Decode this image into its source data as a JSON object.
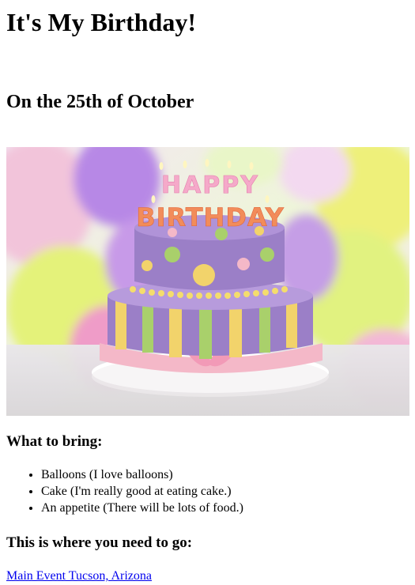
{
  "header": {
    "title": "It's My Birthday!",
    "subtitle": "On the 25th of October"
  },
  "hero": {
    "cake_text_top": "HAPPY",
    "cake_text_bottom": "BIRTHDAY",
    "colors": {
      "cake_purple": "#9b7fc7",
      "stripe_yellow": "#f2d36b",
      "stripe_green": "#a9d06b",
      "ribbon_pink": "#f4b8c8",
      "balloon_yellow": "#e8f06a",
      "balloon_purple": "#c6a2e8"
    }
  },
  "bring": {
    "heading": "What to bring:",
    "items": [
      "Balloons (I love balloons)",
      "Cake (I'm really good at eating cake.)",
      "An appetite (There will be lots of food.)"
    ]
  },
  "location": {
    "heading": "This is where you need to go:",
    "link_text": "Main Event Tucson, Arizona"
  }
}
